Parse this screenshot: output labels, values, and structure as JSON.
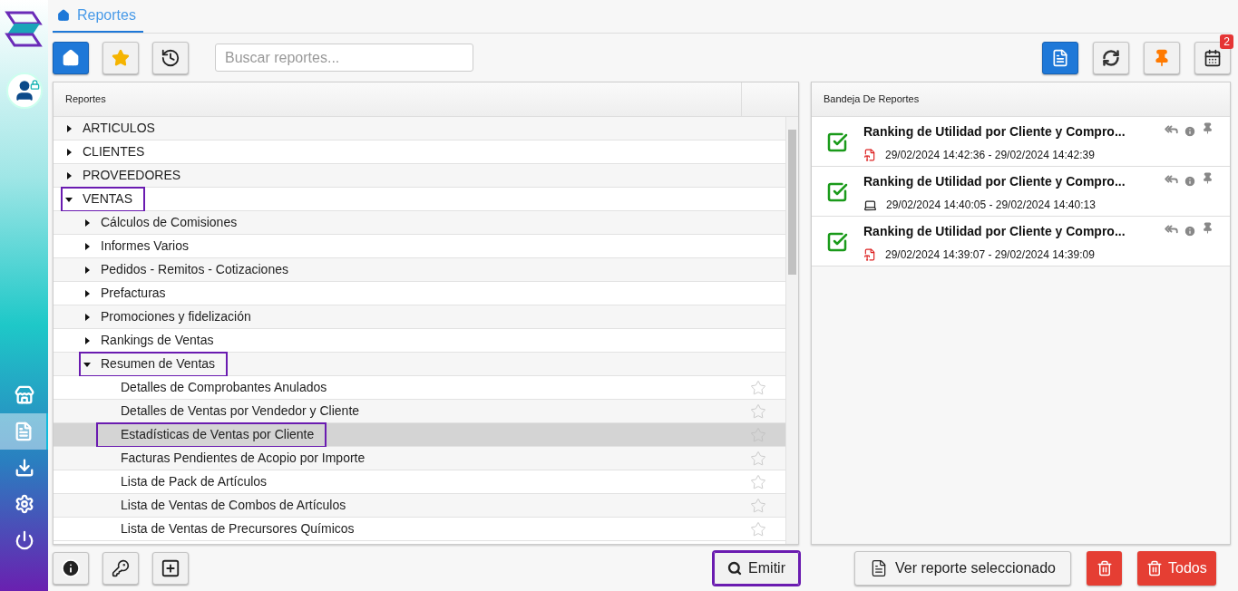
{
  "tab": {
    "label": "Reportes",
    "selected": true
  },
  "search": {
    "placeholder": "Buscar reportes..."
  },
  "notifications": {
    "count": "2"
  },
  "tree": {
    "title": "Reportes",
    "items": [
      {
        "kind": "folder",
        "label": "ARTICULOS",
        "expanded": false,
        "highlighted": false
      },
      {
        "kind": "folder",
        "label": "CLIENTES",
        "expanded": false,
        "highlighted": false
      },
      {
        "kind": "folder",
        "label": "PROVEEDORES",
        "expanded": false,
        "highlighted": false
      },
      {
        "kind": "folder",
        "label": "VENTAS",
        "expanded": true,
        "highlighted": true,
        "children": [
          {
            "kind": "folder",
            "label": "Cálculos de Comisiones",
            "expanded": false,
            "highlighted": false
          },
          {
            "kind": "folder",
            "label": "Informes Varios",
            "expanded": false,
            "highlighted": false
          },
          {
            "kind": "folder",
            "label": "Pedidos - Remitos - Cotizaciones",
            "expanded": false,
            "highlighted": false
          },
          {
            "kind": "folder",
            "label": "Prefacturas",
            "expanded": false,
            "highlighted": false
          },
          {
            "kind": "folder",
            "label": "Promociones y fidelización",
            "expanded": false,
            "highlighted": false
          },
          {
            "kind": "folder",
            "label": "Rankings de Ventas",
            "expanded": false,
            "highlighted": false
          },
          {
            "kind": "folder",
            "label": "Resumen de Ventas",
            "expanded": true,
            "highlighted": true,
            "children": [
              {
                "kind": "report",
                "label": "Detalles de Comprobantes Anulados",
                "favorite": false,
                "selected": false,
                "highlighted": false
              },
              {
                "kind": "report",
                "label": "Detalles de Ventas por Vendedor y Cliente",
                "favorite": false,
                "selected": false,
                "highlighted": false
              },
              {
                "kind": "report",
                "label": "Estadísticas de Ventas por Cliente",
                "favorite": false,
                "selected": true,
                "highlighted": true
              },
              {
                "kind": "report",
                "label": "Facturas Pendientes de Acopio por Importe",
                "favorite": false,
                "selected": false,
                "highlighted": false
              },
              {
                "kind": "report",
                "label": "Lista de Pack de Artículos",
                "favorite": false,
                "selected": false,
                "highlighted": false
              },
              {
                "kind": "report",
                "label": "Lista de Ventas de Combos de Artículos",
                "favorite": false,
                "selected": false,
                "highlighted": false
              },
              {
                "kind": "report",
                "label": "Lista de Ventas de Precursores Químicos",
                "favorite": false,
                "selected": false,
                "highlighted": false
              }
            ]
          }
        ]
      }
    ]
  },
  "tray": {
    "title": "Bandeja De Reportes",
    "items": [
      {
        "kind": "pdf",
        "title": "Ranking de Utilidad por Cliente y Compro...",
        "range": "29/02/2024 14:42:36 - 29/02/2024 14:42:39"
      },
      {
        "kind": "screen",
        "title": "Ranking de Utilidad por Cliente y Compro...",
        "range": "29/02/2024 14:40:05 - 29/02/2024 14:40:13"
      },
      {
        "kind": "pdf",
        "title": "Ranking de Utilidad por Cliente y Compro...",
        "range": "29/02/2024 14:39:07 - 29/02/2024 14:39:09"
      }
    ]
  },
  "emit": {
    "label": "Emitir",
    "highlighted": true
  },
  "view_button": {
    "label": "Ver reporte seleccionado"
  },
  "delete_all": {
    "label": "Todos"
  },
  "sidebar": [
    {
      "selected": false
    },
    {
      "selected": true
    },
    {
      "selected": false
    },
    {
      "selected": false
    },
    {
      "selected": false
    }
  ]
}
